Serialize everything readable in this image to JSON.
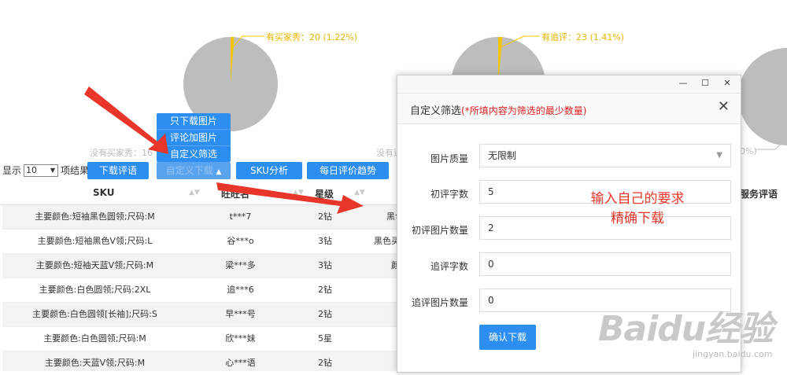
{
  "pies": {
    "pie1": {
      "callout": "有买家秀：20 (1.22%)",
      "under": "没有买家秀：16"
    },
    "pie2": {
      "callout": "有追评：23 (1.41%)",
      "under": "没有追"
    },
    "pie3": {
      "under": "0%)"
    }
  },
  "table_controls": {
    "show_label": "显示",
    "page_size": "10",
    "suffix": "项结果",
    "buttons": {
      "download_reviews": "下载评语",
      "custom_dropdown": "自定义下载",
      "sku_analysis": "SKU分析",
      "daily_trend": "每日评价趋势"
    }
  },
  "dropdown_menu": {
    "items": [
      "只下载图片",
      "评论加图片",
      "自定义筛选"
    ]
  },
  "table": {
    "headers": {
      "sku": "SKU",
      "wangwang": "旺旺名",
      "stars": "星级",
      "service": "服务评语"
    },
    "rows": [
      {
        "sku": "主要颜色:短袖黑色圆领;尺码:M",
        "name": "t***7",
        "stars": "2钻",
        "extra": "黑色"
      },
      {
        "sku": "主要颜色:短袖黑色V领;尺码:L",
        "name": "谷***o",
        "stars": "3钻",
        "extra": "黑色买"
      },
      {
        "sku": "主要颜色:短袖天蓝V领;尺码:M",
        "name": "梁***多",
        "stars": "3钻",
        "extra": "颜"
      },
      {
        "sku": "主要颜色:白色圆领;尺码:2XL",
        "name": "追***6",
        "stars": "2钻",
        "extra": ""
      },
      {
        "sku": "主要颜色:白色圆领[长袖];尺码:S",
        "name": "早***号",
        "stars": "2钻",
        "extra": ""
      },
      {
        "sku": "主要颜色:白色圆领;尺码:M",
        "name": "欣***妹",
        "stars": "5星",
        "extra": ""
      },
      {
        "sku": "主要颜色:天蓝V领;尺码:M",
        "name": "心***语",
        "stars": "2钻",
        "extra": ""
      }
    ]
  },
  "dialog": {
    "title": "自定义筛选",
    "hint": "(*所填内容为筛选的最少数量)",
    "close": "✕",
    "fields": {
      "image_quality": {
        "label": "图片质量",
        "value": "无限制"
      },
      "first_review_chars": {
        "label": "初评字数",
        "value": "5"
      },
      "first_review_images": {
        "label": "初评图片数量",
        "value": "2"
      },
      "followup_chars": {
        "label": "追评字数",
        "value": "0"
      },
      "followup_images": {
        "label": "追评图片数量",
        "value": "0"
      }
    },
    "confirm": "确认下载"
  },
  "annotation": {
    "line1": "输入自己的要求",
    "line2": "精确下载"
  },
  "watermark": {
    "main": "Baidu经验",
    "sub": "jingyan.baidu.com"
  },
  "colors": {
    "accent": "#2b8ef0",
    "pie": "#bdbdbd",
    "pie_slice": "#f5c400",
    "arrow": "#e8372a"
  }
}
